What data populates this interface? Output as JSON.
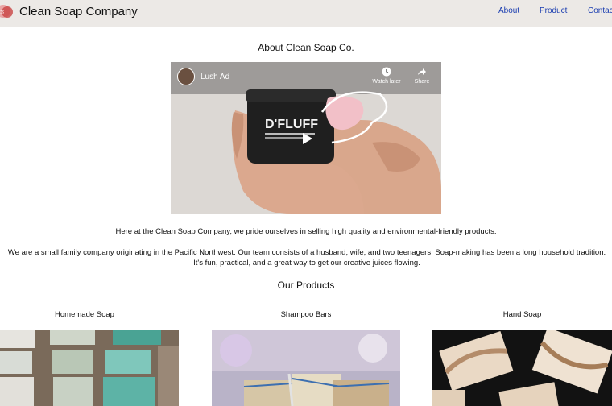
{
  "header": {
    "brand": "Clean Soap Company",
    "logo_icon": "soap-logo-icon",
    "nav": {
      "about": "About",
      "product": "Product",
      "contact": "Contac"
    }
  },
  "about": {
    "title": "About Clean Soap Co.",
    "video": {
      "title": "Lush Ad",
      "watch_later": "Watch later",
      "share": "Share",
      "product_text": "D'FLUFF"
    },
    "intro": "Here at the Clean Soap Company, we pride ourselves in selling high quality and environmental-friendly products.",
    "description": "We are a small family company originating in the Pacific Northwest. Our team consists of a husband, wife, and two teenagers. Soap-making has been a long household tradition. It's fun, practical, and a great way to get our creative juices flowing."
  },
  "products": {
    "title": "Our Products",
    "items": [
      {
        "label": "Homemade Soap"
      },
      {
        "label": "Shampoo Bars"
      },
      {
        "label": "Hand Soap"
      }
    ]
  },
  "colors": {
    "header_bg": "#ece9e6",
    "nav_link": "#1a3db0"
  }
}
